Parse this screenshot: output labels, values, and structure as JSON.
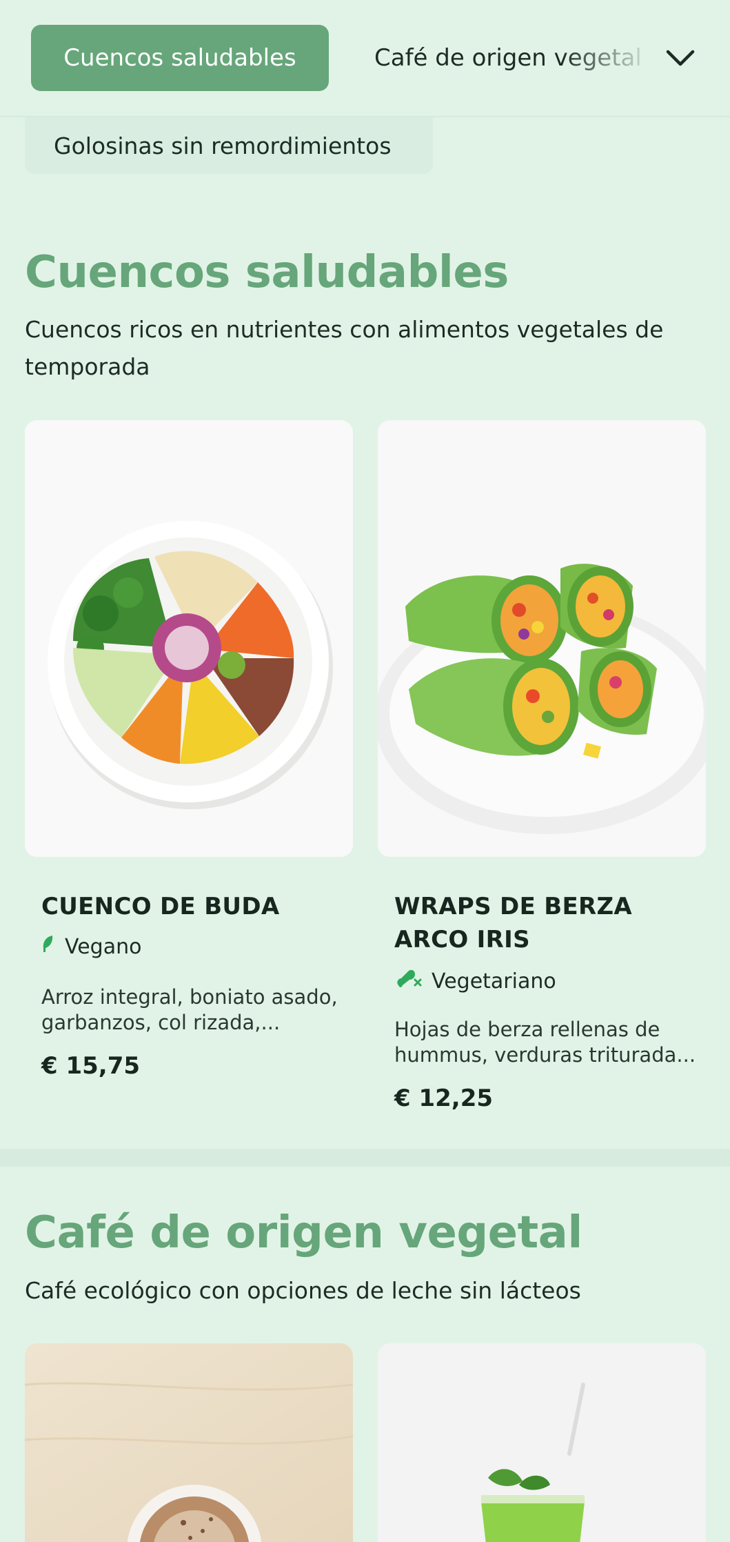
{
  "nav": {
    "active_label": "Cuencos saludables",
    "next_label": "Café de origen vegetal",
    "row2_label": "Golosinas sin remordimientos",
    "expand_icon": "chevron-down-icon"
  },
  "sections": [
    {
      "title": "Cuencos saludables",
      "subtitle": "Cuencos ricos en nutrientes con alimentos vegetales de temporada",
      "items": [
        {
          "name": "CUENCO DE BUDA",
          "diet": "Vegano",
          "diet_icon": "leaf-icon",
          "description": "Arroz integral, boniato asado, garbanzos, col rizada,...",
          "price": "€ 15,75"
        },
        {
          "name": "WRAPS DE BERZA ARCO IRIS",
          "diet": "Vegetariano",
          "diet_icon": "no-meat-icon",
          "description": "Hojas de berza rellenas de hummus, verduras triturada...",
          "price": "€ 12,25"
        }
      ]
    },
    {
      "title": "Café de origen vegetal",
      "subtitle": "Café ecológico con opciones de leche sin lácteos"
    }
  ],
  "colors": {
    "background": "#e1f3e6",
    "accent": "#66a67a",
    "text": "#1d2b26",
    "diet_icon": "#2faa5c"
  }
}
